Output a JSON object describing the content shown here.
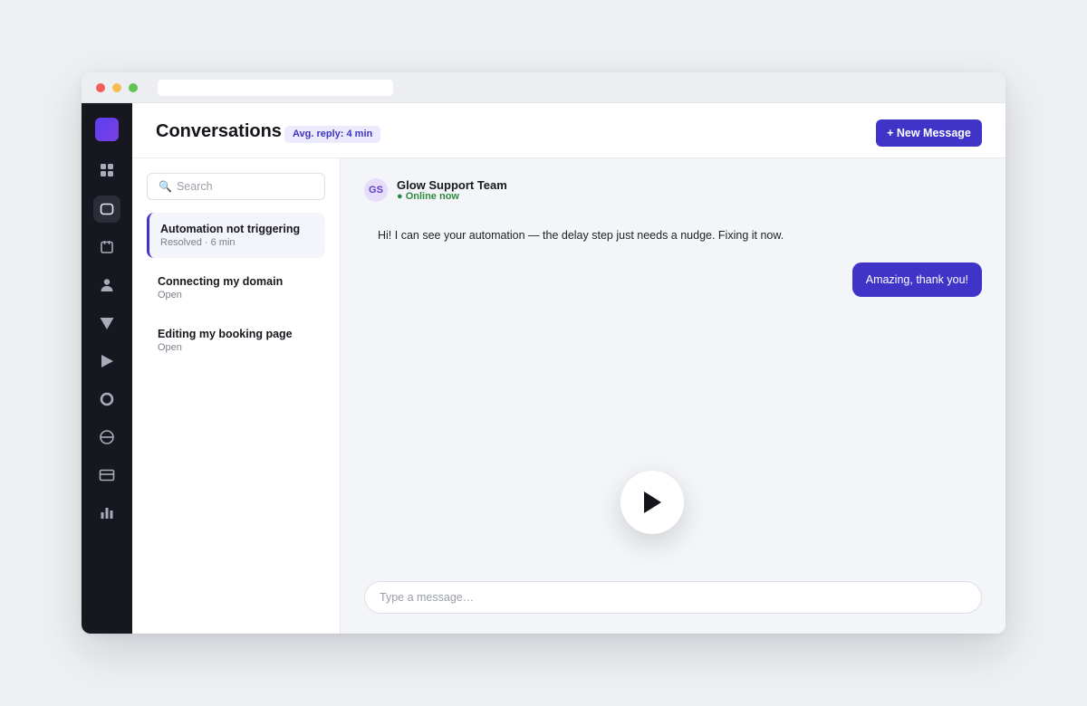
{
  "window": {
    "url": ""
  },
  "rail": {
    "icons": [
      {
        "name": "grid-icon",
        "active": false
      },
      {
        "name": "chat-icon",
        "active": true
      },
      {
        "name": "calendar-icon",
        "active": false
      },
      {
        "name": "contacts-icon",
        "active": false
      },
      {
        "name": "funnel-icon",
        "active": false
      },
      {
        "name": "send-icon",
        "active": false
      },
      {
        "name": "circle-icon",
        "active": false
      },
      {
        "name": "globe-icon",
        "active": false
      },
      {
        "name": "card-icon",
        "active": false
      },
      {
        "name": "chart-icon",
        "active": false
      }
    ]
  },
  "header": {
    "title": "Conversations",
    "badge": "Avg. reply: 4 min",
    "new_message_label": "+ New Message"
  },
  "list": {
    "search_placeholder": "Search",
    "items": [
      {
        "title": "Automation not triggering",
        "subtitle": "Resolved · 6 min",
        "active": true
      },
      {
        "title": "Connecting my domain",
        "subtitle": "Open",
        "active": false
      },
      {
        "title": "Editing my booking page",
        "subtitle": "Open",
        "active": false
      }
    ]
  },
  "chat": {
    "contact_initials": "GS",
    "contact_name": "Glow Support Team",
    "contact_status": "● Online now",
    "messages": [
      {
        "direction": "in",
        "text": "Hi! I can see your automation — the delay step just needs a nudge. Fixing it now."
      },
      {
        "direction": "out",
        "text": "Amazing, thank you!"
      }
    ],
    "composer_placeholder": "Type a message…"
  },
  "colors": {
    "accent": "#3f33c8",
    "rail_background": "#17171f",
    "online_green": "#2e8b3d"
  }
}
